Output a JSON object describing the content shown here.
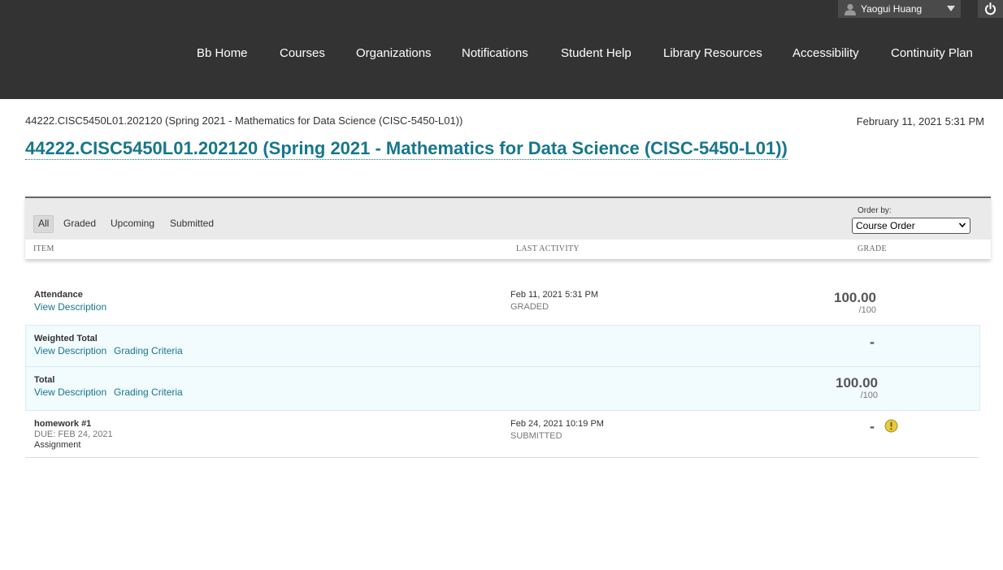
{
  "user": {
    "name": "Yaogui Huang"
  },
  "nav": {
    "items": [
      "Bb Home",
      "Courses",
      "Organizations",
      "Notifications",
      "Student Help",
      "Library Resources",
      "Accessibility",
      "Continuity Plan"
    ]
  },
  "header": {
    "breadcrumb": "44222.CISC5450L01.202120 (Spring 2021 - Mathematics for Data Science (CISC-5450-L01))",
    "date": "February 11, 2021 5:31 PM",
    "title": "44222.CISC5450L01.202120 (Spring 2021 - Mathematics for Data Science (CISC-5450-L01))"
  },
  "filters": {
    "tabs": [
      "All",
      "Graded",
      "Upcoming",
      "Submitted"
    ],
    "active": "All",
    "order_label": "Order by:",
    "order_value": "Course Order"
  },
  "columns": {
    "item": "ITEM",
    "last_activity": "LAST ACTIVITY",
    "grade": "GRADE"
  },
  "rows": [
    {
      "name": "Attendance",
      "links": [
        "View Description"
      ],
      "activity_date": "Feb 11, 2021 5:31 PM",
      "activity_status": "GRADED",
      "grade": "100.00",
      "max": "/100"
    },
    {
      "name": "Weighted Total",
      "links": [
        "View Description",
        "Grading Criteria"
      ],
      "grade": "-"
    },
    {
      "name": "Total",
      "links": [
        "View Description",
        "Grading Criteria"
      ],
      "grade": "100.00",
      "max": "/100"
    },
    {
      "name": "homework #1",
      "due": "DUE: FEB 24, 2021",
      "type": "Assignment",
      "activity_date": "Feb 24, 2021 10:19 PM",
      "activity_status": "SUBMITTED",
      "grade": "-",
      "status_icon": "needs-grading-icon"
    }
  ],
  "colors": {
    "topbar": "#333333",
    "link": "#16778c",
    "calc_row": "#f2fbfe",
    "warning": "#e8c93a"
  }
}
